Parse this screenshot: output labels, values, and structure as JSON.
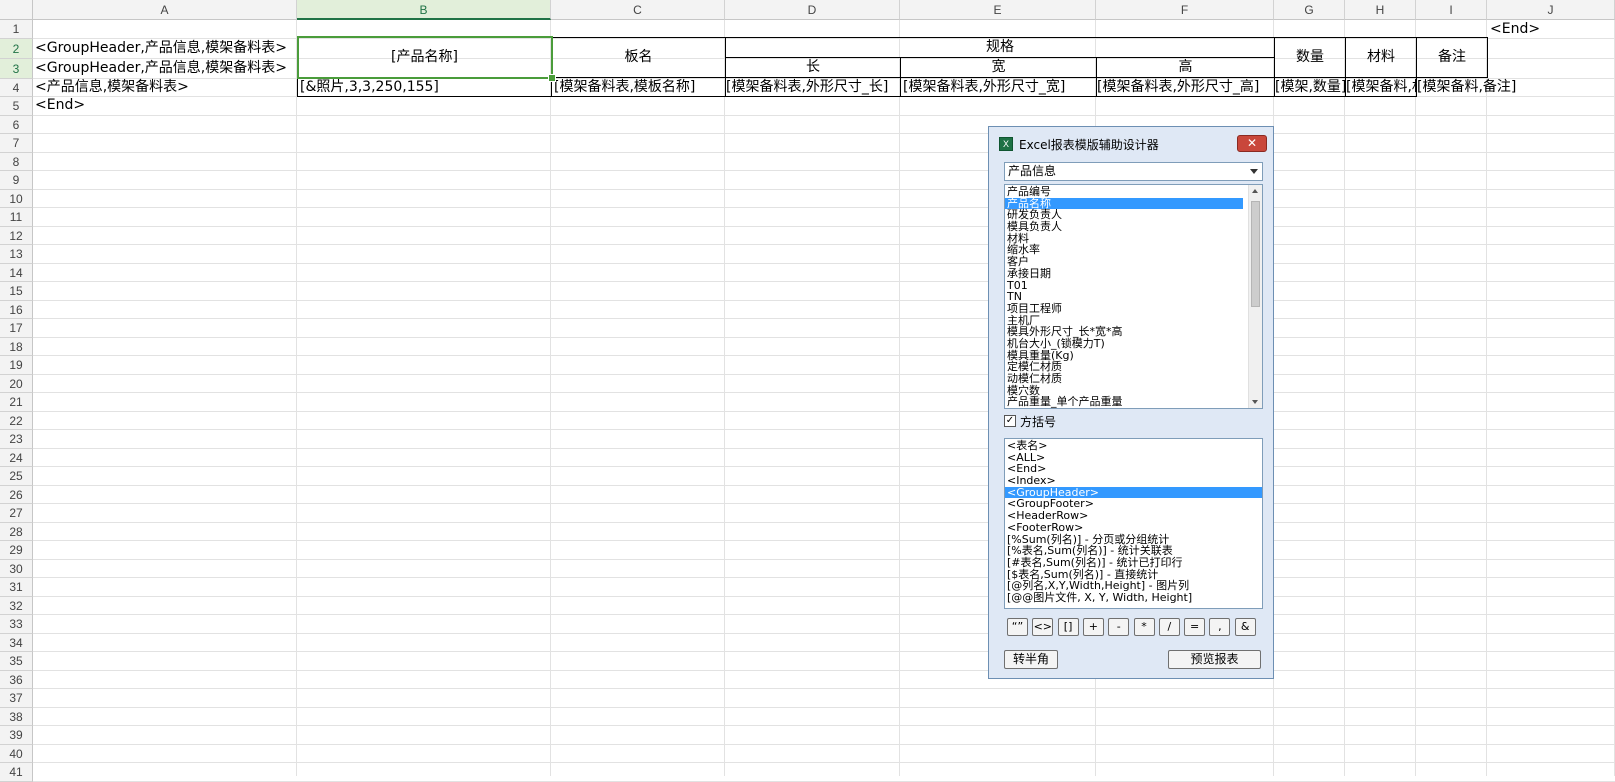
{
  "columns": [
    "A",
    "B",
    "C",
    "D",
    "E",
    "F",
    "G",
    "H",
    "I",
    "J"
  ],
  "selected_column": "B",
  "rows": [
    "1",
    "2",
    "3",
    "4",
    "5",
    "6",
    "7",
    "8",
    "9",
    "10",
    "11",
    "12",
    "13",
    "14",
    "15",
    "16",
    "17",
    "18",
    "19",
    "20",
    "21",
    "22",
    "23",
    "24",
    "25",
    "26",
    "27",
    "28",
    "29",
    "30",
    "31",
    "32",
    "33",
    "34",
    "35",
    "36",
    "37",
    "38",
    "39",
    "40",
    "41"
  ],
  "cells": {
    "j1": "<End>",
    "a2": "<GroupHeader,产品信息,模架备料表>",
    "a3": "<GroupHeader,产品信息,模架备料表>",
    "a4": "<产品信息,模架备料表>",
    "a5": "<End>",
    "b23": "[产品名称]",
    "c23": "板名",
    "d2": "规格",
    "d3": "长",
    "e3": "宽",
    "f3": "高",
    "g23": "数量",
    "h23": "材料",
    "i23": "备注",
    "b4": "[&照片,3,3,250,155]",
    "c4": "[模架备料表,模板名称]",
    "d4": "[模架备料表,外形尺寸_长]",
    "e4": "[模架备料表,外形尺寸_宽]",
    "f4": "[模架备料表,外形尺寸_高]",
    "g4": "[模架,数量]",
    "h4": "[模架备料,材料]",
    "i4": "[模架备料,备注]"
  },
  "dialog": {
    "title": "Excel报表模版辅助设计器",
    "app_icon": "X",
    "close_label": "✕",
    "table_select": "产品信息",
    "fields": [
      "产品编号",
      "产品名称",
      "研发负责人",
      "模具负责人",
      "材料",
      "缩水率",
      "客户",
      "承接日期",
      "T01",
      "TN",
      "项目工程师",
      "主机厂",
      "模具外形尺寸_长*宽*高",
      "机台大小_(锁模力T)",
      "模具重量(Kg)",
      "定模仁材质",
      "动模仁材质",
      "模穴数",
      "产品重量_单个产品重量"
    ],
    "selected_field_index": 1,
    "bracket_label": "方括号",
    "bracket_checked": true,
    "tags": [
      "<表名>",
      "<ALL>",
      "<End>",
      "<Index>",
      "<GroupHeader>",
      "<GroupFooter>",
      "<HeaderRow>",
      "<FooterRow>",
      "[%Sum(列名)] - 分页或分组统计",
      "[%表名,Sum(列名)] - 统计关联表",
      "[#表名,Sum(列名)] - 统计已打印行",
      "[$表名,Sum(列名)] - 直接统计",
      "[@列名,X,Y,Width,Height] - 图片列",
      "[@@图片文件, X, Y, Width, Height]"
    ],
    "selected_tag_index": 4,
    "symbols": [
      "“”",
      "<>",
      "[]",
      "+",
      "-",
      "*",
      "/",
      "=",
      ",",
      "&"
    ],
    "convert_label": "转半角",
    "preview_label": "预览报表"
  },
  "colors": {
    "accent": "#217346",
    "selection": "#3399ff",
    "cell_select": "#4a9c3a"
  }
}
